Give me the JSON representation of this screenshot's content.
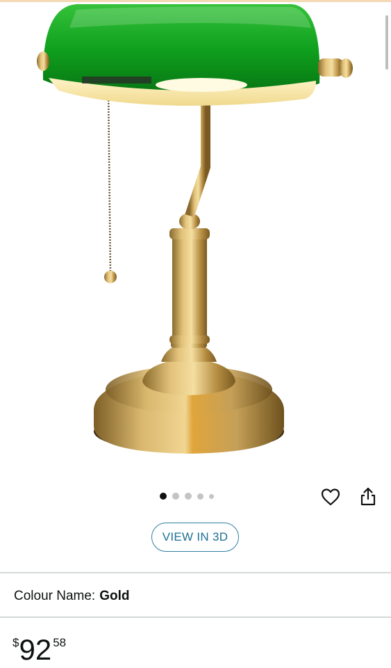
{
  "product": {
    "image_alt": "Green banker's desk lamp with brass base",
    "carousel": {
      "total_images": 5,
      "active_index": 0
    },
    "actions": {
      "wishlist_icon": "heart-outline-icon",
      "share_icon": "share-icon"
    }
  },
  "view_3d": {
    "label": "VIEW IN 3D"
  },
  "variation": {
    "label": "Colour Name:",
    "value": "Gold"
  },
  "price": {
    "currency": "$",
    "whole": "92",
    "fraction": "58"
  },
  "colors": {
    "accent": "#1d6f95",
    "shade_green": "#0b8a1a",
    "brass": "#c9a559"
  }
}
